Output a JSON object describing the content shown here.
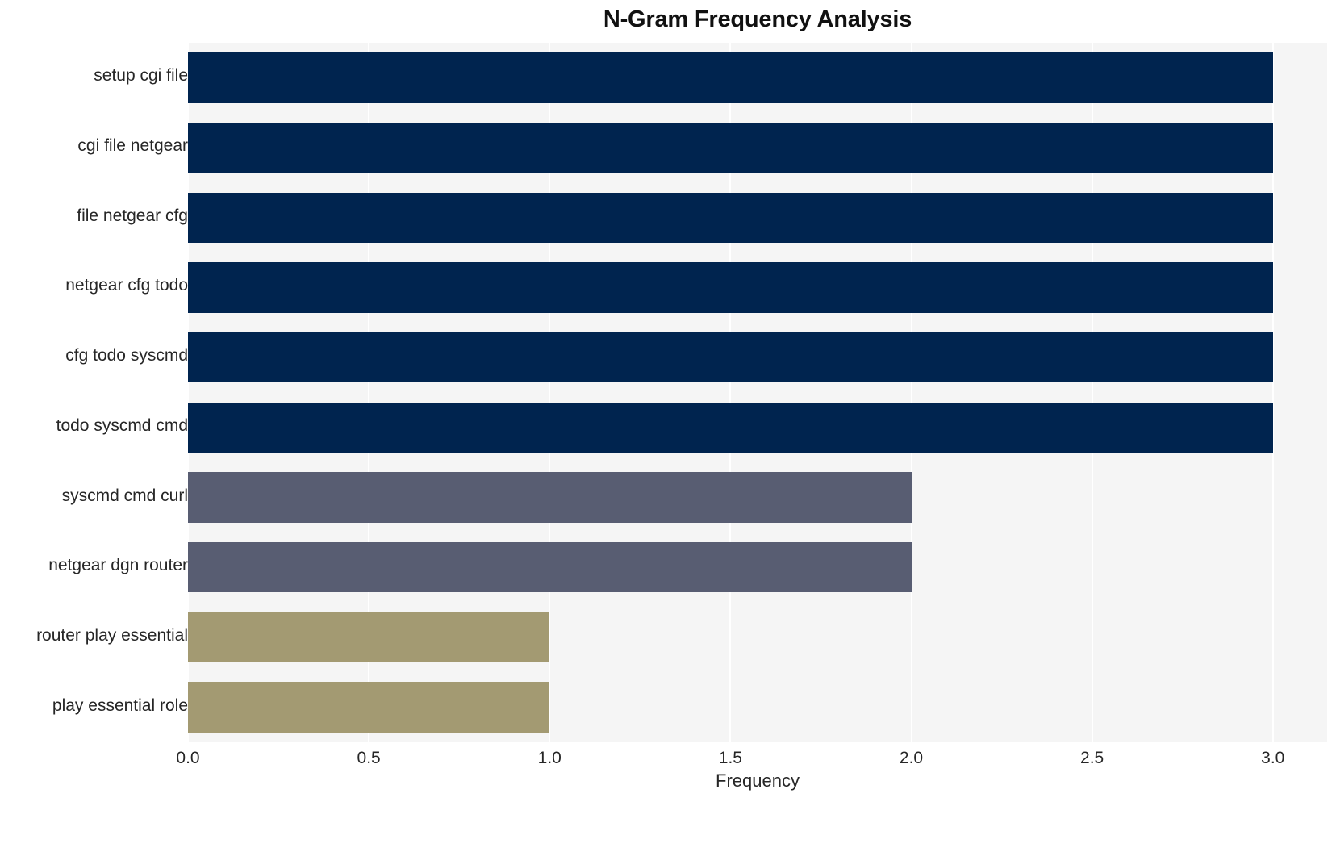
{
  "chart_data": {
    "type": "bar",
    "orientation": "horizontal",
    "title": "N-Gram Frequency Analysis",
    "xlabel": "Frequency",
    "ylabel": "",
    "categories": [
      "setup cgi file",
      "cgi file netgear",
      "file netgear cfg",
      "netgear cfg todo",
      "cfg todo syscmd",
      "todo syscmd cmd",
      "syscmd cmd curl",
      "netgear dgn router",
      "router play essential",
      "play essential role"
    ],
    "values": [
      3,
      3,
      3,
      3,
      3,
      3,
      2,
      2,
      1,
      1
    ],
    "bar_colors": [
      "#00244f",
      "#00244f",
      "#00244f",
      "#00244f",
      "#00244f",
      "#00244f",
      "#585d72",
      "#585d72",
      "#a39a72",
      "#a39a72"
    ],
    "xlim": [
      0.0,
      3.15
    ],
    "xticks": [
      0.0,
      0.5,
      1.0,
      1.5,
      2.0,
      2.5,
      3.0
    ],
    "xticklabels": [
      "0.0",
      "0.5",
      "1.0",
      "1.5",
      "2.0",
      "2.5",
      "3.0"
    ],
    "grid": true,
    "grid_axis": "x",
    "grid_color": "#ffffff",
    "plot_background": "#f5f5f5",
    "figure_background": "#ffffff",
    "legend": null
  }
}
